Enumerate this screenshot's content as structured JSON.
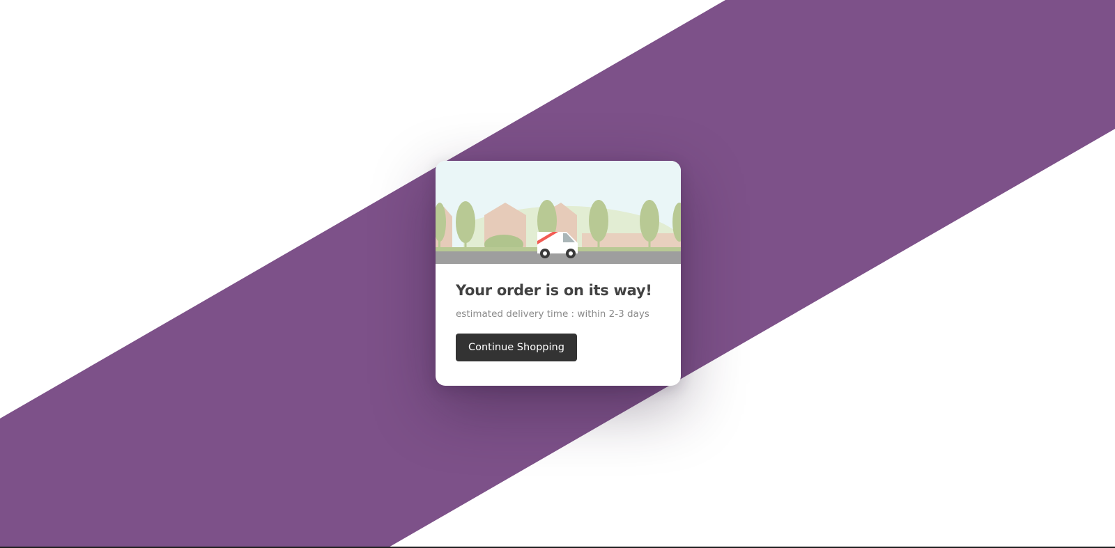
{
  "background": {
    "base_color": "#ffffff",
    "band_color": "#7d5189"
  },
  "modal": {
    "title": "Your order is on its way!",
    "subtitle": "estimated delivery time : within 2-3 days",
    "button_label": "Continue Shopping",
    "button_color": "#333333",
    "illustration": {
      "icon": "delivery-van-scene",
      "sky_color": "#eaf6f7",
      "hill_color": "#e2edd3",
      "tree_color": "#b8c994",
      "house_color": "#e6cbb9",
      "road_color": "#9e9e9e",
      "van_stripe_color": "#f25c54"
    }
  }
}
